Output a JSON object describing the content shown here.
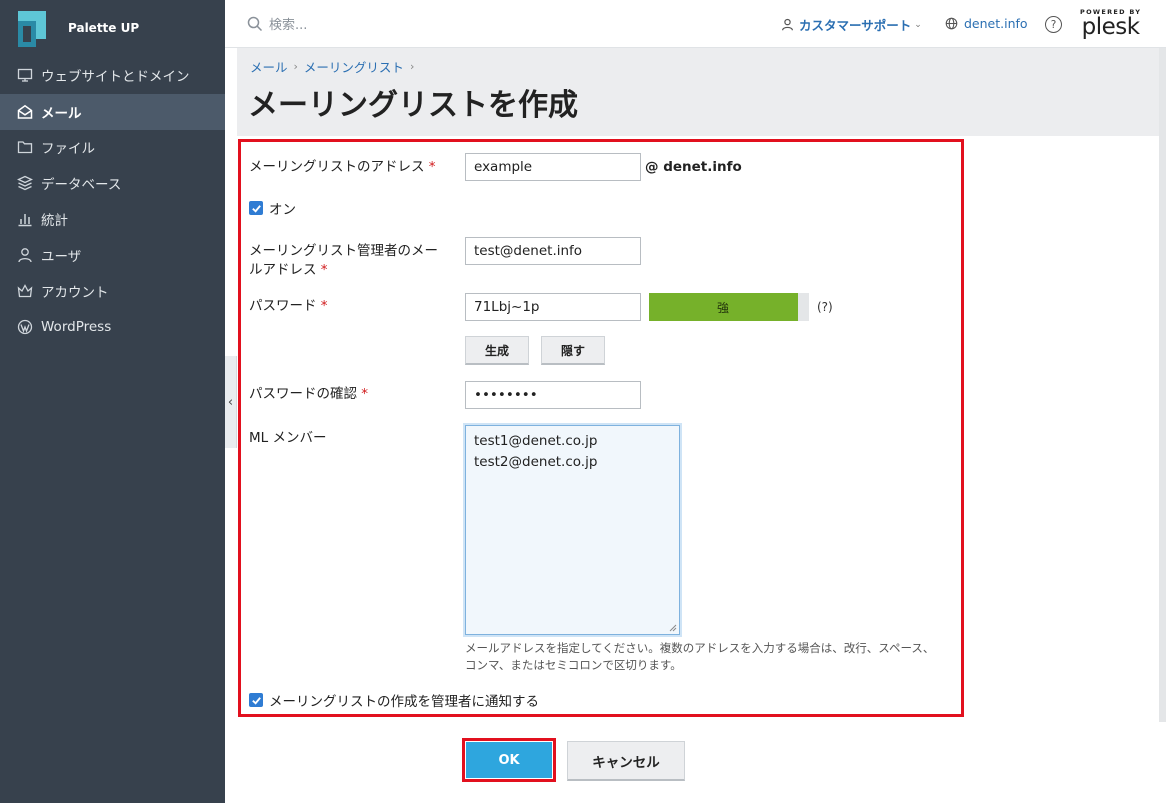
{
  "app": {
    "brand": "Palette UP"
  },
  "sidebar": {
    "items": [
      {
        "label": "ウェブサイトとドメイン",
        "icon": "monitor-icon",
        "active": false
      },
      {
        "label": "メール",
        "icon": "mail-icon",
        "active": true
      },
      {
        "label": "ファイル",
        "icon": "folder-icon",
        "active": false
      },
      {
        "label": "データベース",
        "icon": "database-icon",
        "active": false
      },
      {
        "label": "統計",
        "icon": "chart-icon",
        "active": false
      },
      {
        "label": "ユーザ",
        "icon": "user-icon",
        "active": false
      },
      {
        "label": "アカウント",
        "icon": "crown-icon",
        "active": false
      },
      {
        "label": "WordPress",
        "icon": "wordpress-icon",
        "active": false
      }
    ],
    "collapse_glyph": "‹"
  },
  "header": {
    "search_placeholder": "検索...",
    "support_label": "カスタマーサポート",
    "domain_label": "denet.info",
    "help_glyph": "?",
    "plesk_powered": "POWERED BY",
    "plesk_name": "plesk"
  },
  "breadcrumb": {
    "items": [
      "メール",
      "メーリングリスト"
    ],
    "separator": "›"
  },
  "page_title": "メーリングリストを作成",
  "form": {
    "address_label": "メーリングリストのアドレス",
    "address_value": "example",
    "address_domain": "@ denet.info",
    "on_label": "オン",
    "admin_email_label_line1": "メーリングリスト管理者のメー",
    "admin_email_label_line2": "ルアドレス",
    "admin_email_value": "test@denet.info",
    "password_label": "パスワード",
    "password_value": "71Lbj~1p",
    "strength_label": "強",
    "strength_level": 0.93,
    "help_link": "(?)",
    "generate_button": "生成",
    "hide_button": "隠す",
    "confirm_label": "パスワードの確認",
    "confirm_value": "••••••••",
    "members_label": "ML メンバー",
    "members": [
      "test1@denet.co.jp",
      "test2@denet.co.jp"
    ],
    "hint_line1": "メールアドレスを指定してください。複数のアドレスを入力する場合は、改行、スペース、",
    "hint_line2": "コンマ、またはセミコロンで区切ります。",
    "notify_label": "メーリングリストの作成を管理者に通知する",
    "required_mark": "*"
  },
  "actions": {
    "ok_label": "OK",
    "cancel_label": "キャンセル"
  },
  "colors": {
    "sidebar_bg": "#37414d",
    "highlight": "#e2101e",
    "ok_button": "#2ea6de",
    "strength_fill": "#76b12a",
    "link": "#2b6fb2"
  }
}
